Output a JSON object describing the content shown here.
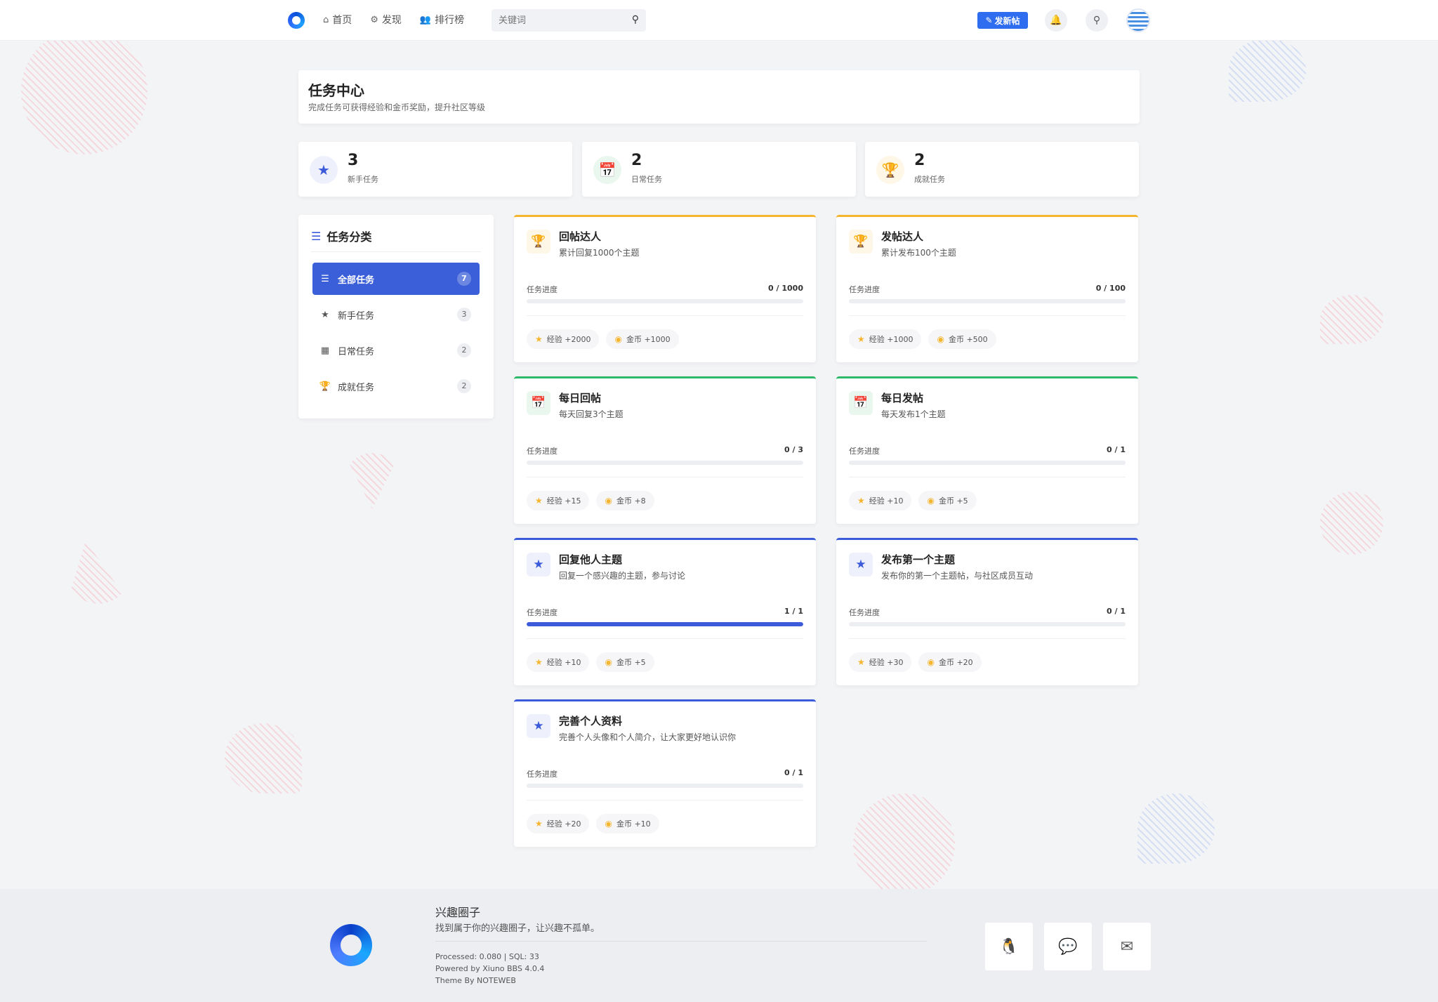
{
  "header": {
    "nav": [
      {
        "icon": "home-icon",
        "label": "首页"
      },
      {
        "icon": "gear-icon",
        "label": "发现"
      },
      {
        "icon": "users-icon",
        "label": "排行榜"
      }
    ],
    "search": {
      "placeholder": "关键词"
    },
    "post_button": "发新帖"
  },
  "page": {
    "title": "任务中心",
    "subtitle": "完成任务可获得经验和金币奖励，提升社区等级"
  },
  "stats": [
    {
      "value": "3",
      "label": "新手任务",
      "icon": "star-icon",
      "color": "#3b5bdb"
    },
    {
      "value": "2",
      "label": "日常任务",
      "icon": "calendar-check-icon",
      "color": "#2fb86a"
    },
    {
      "value": "2",
      "label": "成就任务",
      "icon": "trophy-icon",
      "color": "#f5b52e"
    }
  ],
  "sidebar": {
    "title": "任务分类",
    "items": [
      {
        "label": "全部任务",
        "count": "7",
        "icon": "list-icon",
        "active": true
      },
      {
        "label": "新手任务",
        "count": "3",
        "icon": "star-icon",
        "active": false
      },
      {
        "label": "日常任务",
        "count": "2",
        "icon": "calendar-icon",
        "active": false
      },
      {
        "label": "成就任务",
        "count": "2",
        "icon": "trophy-icon",
        "active": false
      }
    ]
  },
  "tasks": [
    {
      "title": "回帖达人",
      "desc": "累计回复1000个主题",
      "type": "achievement",
      "progress_label": "任务进度",
      "progress": "0 / 1000",
      "fraction": 0,
      "exp": "经验 +2000",
      "coin": "金币 +1000"
    },
    {
      "title": "发帖达人",
      "desc": "累计发布100个主题",
      "type": "achievement",
      "progress_label": "任务进度",
      "progress": "0 / 100",
      "fraction": 0,
      "exp": "经验 +1000",
      "coin": "金币 +500"
    },
    {
      "title": "每日回帖",
      "desc": "每天回复3个主题",
      "type": "daily",
      "progress_label": "任务进度",
      "progress": "0 / 3",
      "fraction": 0,
      "exp": "经验 +15",
      "coin": "金币 +8"
    },
    {
      "title": "每日发帖",
      "desc": "每天发布1个主题",
      "type": "daily",
      "progress_label": "任务进度",
      "progress": "0 / 1",
      "fraction": 0,
      "exp": "经验 +10",
      "coin": "金币 +5"
    },
    {
      "title": "回复他人主题",
      "desc": "回复一个感兴趣的主题，参与讨论",
      "type": "newbie",
      "progress_label": "任务进度",
      "progress": "1 / 1",
      "fraction": 1,
      "exp": "经验 +10",
      "coin": "金币 +5"
    },
    {
      "title": "发布第一个主题",
      "desc": "发布你的第一个主题帖，与社区成员互动",
      "type": "newbie",
      "progress_label": "任务进度",
      "progress": "0 / 1",
      "fraction": 0,
      "exp": "经验 +30",
      "coin": "金币 +20"
    },
    {
      "title": "完善个人资料",
      "desc": "完善个人头像和个人简介，让大家更好地认识你",
      "type": "newbie",
      "progress_label": "任务进度",
      "progress": "0 / 1",
      "fraction": 0,
      "exp": "经验 +20",
      "coin": "金币 +10"
    }
  ],
  "footer": {
    "site_name": "兴趣圈子",
    "slogan": "找到属于你的兴趣圈子，让兴趣不孤单。",
    "processed": "Processed: 0.080 | SQL: 33",
    "powered": "Powered by Xiuno BBS 4.0.4",
    "theme": "Theme By NOTEWEB",
    "buttons": [
      "qq-icon",
      "wechat-icon",
      "mail-icon"
    ]
  },
  "colors": {
    "accent": "#3b5bdb",
    "gold": "#f5b52e",
    "green": "#2fb86a",
    "primary_button": "#2e6df0"
  }
}
